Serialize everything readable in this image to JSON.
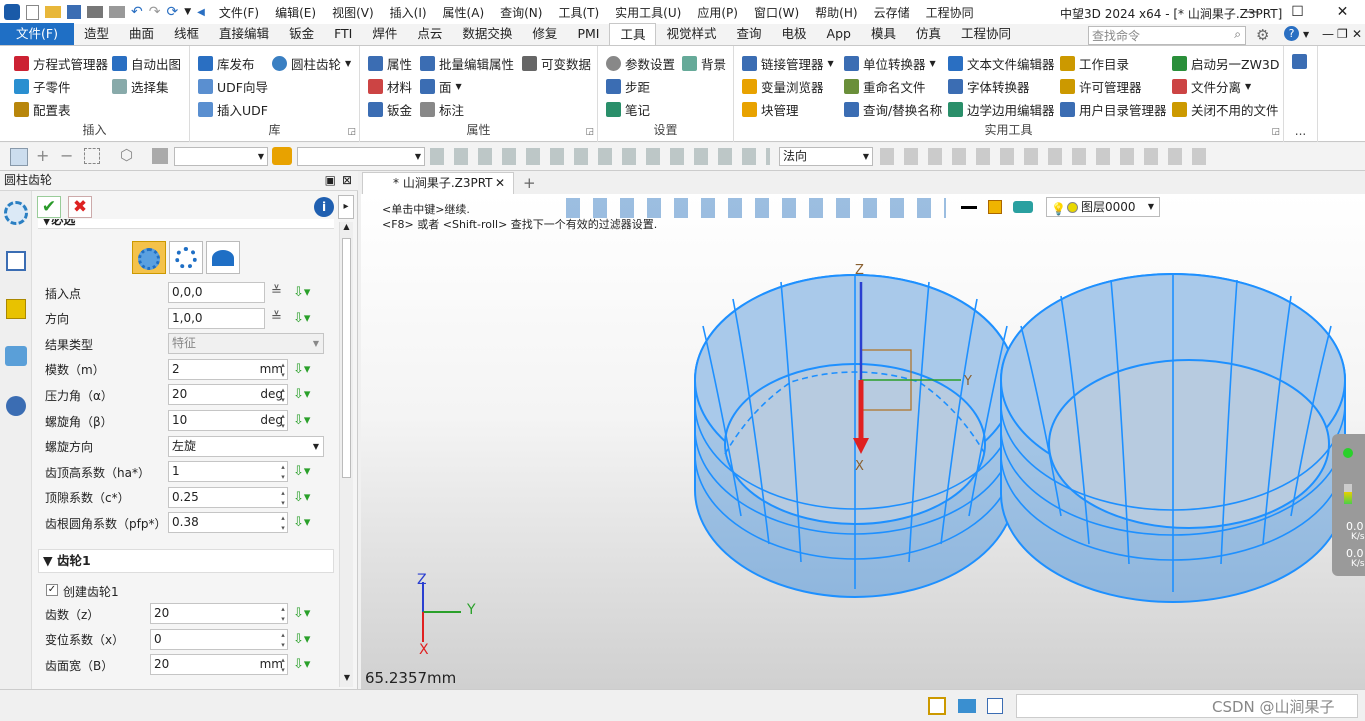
{
  "window": {
    "title": "中望3D 2024 x64 - [* 山涧果子.Z3PRT]",
    "menus": [
      "文件(F)",
      "编辑(E)",
      "视图(V)",
      "插入(I)",
      "属性(A)",
      "查询(N)",
      "工具(T)",
      "实用工具(U)",
      "应用(P)",
      "窗口(W)",
      "帮助(H)",
      "云存储",
      "工程协同"
    ]
  },
  "tabs": [
    "文件(F)",
    "造型",
    "曲面",
    "线框",
    "直接编辑",
    "钣金",
    "FTI",
    "焊件",
    "点云",
    "数据交换",
    "修复",
    "PMI",
    "工具",
    "视觉样式",
    "查询",
    "电极",
    "App",
    "模具",
    "仿真",
    "工程协同"
  ],
  "active_tab": "工具",
  "search": {
    "placeholder": "查找命令"
  },
  "ribbon": {
    "insert": {
      "label": "插入",
      "items": [
        "方程式管理器",
        "自动出图",
        "子零件",
        "选择集",
        "配置表"
      ]
    },
    "library": {
      "label": "库",
      "items": [
        "库发布",
        "圆柱齿轮",
        "UDF向导",
        "插入UDF"
      ]
    },
    "attributes": {
      "label": "属性",
      "items": [
        "属性",
        "批量编辑属性",
        "可变数据",
        "材料",
        "面",
        "钣金",
        "标注"
      ]
    },
    "settings": {
      "label": "设置",
      "items": [
        "参数设置",
        "背景",
        "步距",
        "笔记"
      ]
    },
    "utilities": {
      "label": "实用工具",
      "items": [
        "链接管理器",
        "单位转换器",
        "文本文件编辑器",
        "工作目录",
        "启动另一ZW3D",
        "变量浏览器",
        "重命名文件",
        "字体转换器",
        "许可管理器",
        "文件分离",
        "块管理",
        "查询/替换名称",
        "边学边用编辑器",
        "用户目录管理器",
        "关闭不用的文件"
      ]
    },
    "more": "..."
  },
  "toolbar2": {
    "filter_value": "法向"
  },
  "panel": {
    "title": "圆柱齿轮",
    "section_general": "必选",
    "fields": [
      {
        "label": "插入点",
        "value": "0,0,0",
        "unit": ""
      },
      {
        "label": "方向",
        "value": "1,0,0",
        "unit": ""
      },
      {
        "label": "结果类型",
        "value": "特征",
        "unit": ""
      },
      {
        "label": "模数（m）",
        "value": "2",
        "unit": "mm"
      },
      {
        "label": "压力角（α）",
        "value": "20",
        "unit": "deg"
      },
      {
        "label": "螺旋角（β）",
        "value": "10",
        "unit": "deg"
      },
      {
        "label": "螺旋方向",
        "value": "左旋",
        "unit": ""
      },
      {
        "label": "齿顶高系数（ha*）",
        "value": "1",
        "unit": ""
      },
      {
        "label": "顶隙系数（c*）",
        "value": "0.25",
        "unit": ""
      },
      {
        "label": "齿根圆角系数（pfp*）",
        "value": "0.38",
        "unit": ""
      }
    ],
    "section_gear1": "齿轮1",
    "create_gear1": "创建齿轮1",
    "gear1_fields": [
      {
        "label": "齿数（z）",
        "value": "20",
        "unit": ""
      },
      {
        "label": "变位系数（x）",
        "value": "0",
        "unit": ""
      },
      {
        "label": "齿面宽（B）",
        "value": "20",
        "unit": "mm"
      }
    ]
  },
  "document": {
    "tab_label": "* 山涧果子.Z3PRT"
  },
  "viewport": {
    "hint_line1": "<单击中键>继续.",
    "hint_line2": "<F8> 或者 <Shift-roll> 查找下一个有效的过滤器设置.",
    "layer": "图层0000",
    "measure": "65.2357mm",
    "axis_x": "X",
    "axis_y": "Y",
    "axis_z": "Z",
    "net_up": "0.0",
    "net_up_unit": "K/s",
    "net_down": "0.0",
    "net_down_unit": "K/s"
  },
  "status": {
    "watermark": "CSDN @山涧果子"
  },
  "colors": {
    "accent": "#1f6fc5",
    "mesh": "#1e90ff",
    "mesh_fill": "#9fc3e6"
  }
}
